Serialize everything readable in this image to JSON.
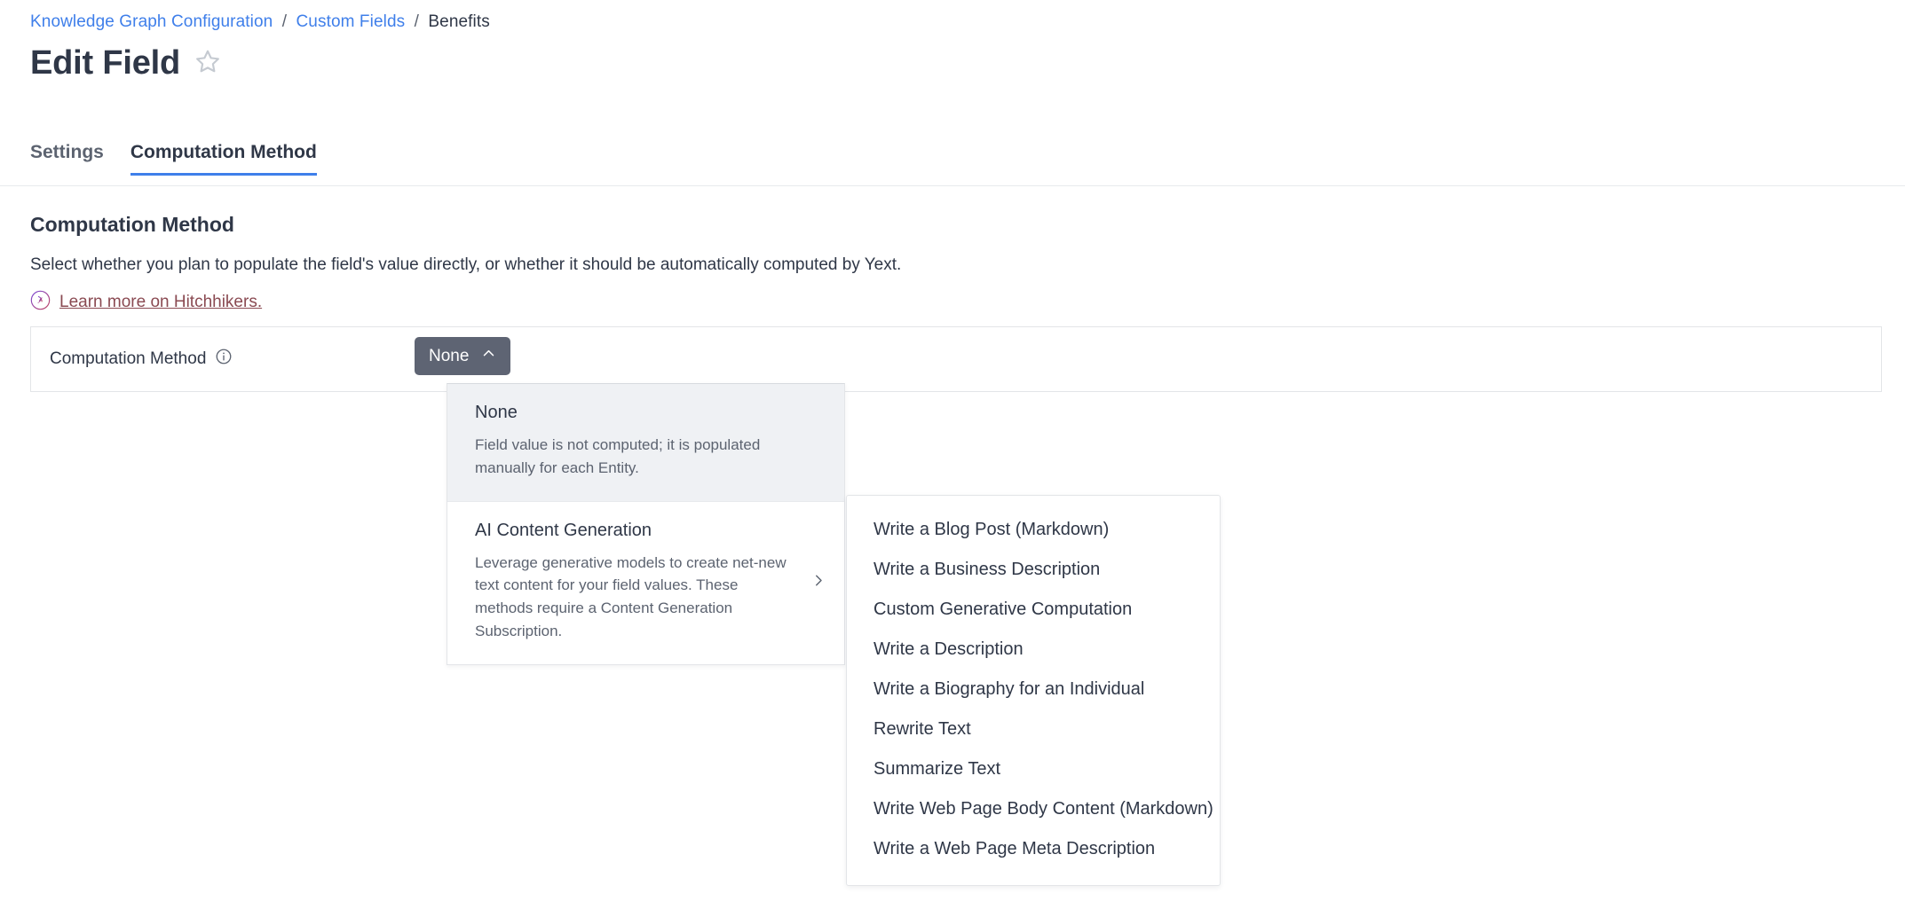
{
  "breadcrumb": {
    "items": [
      {
        "label": "Knowledge Graph Configuration",
        "link": true
      },
      {
        "label": "Custom Fields",
        "link": true
      },
      {
        "label": "Benefits",
        "link": false
      }
    ],
    "separator": "/"
  },
  "header": {
    "title": "Edit Field",
    "favorite_icon": "star-outline-icon"
  },
  "tabs": [
    {
      "label": "Settings",
      "active": false
    },
    {
      "label": "Computation Method",
      "active": true
    }
  ],
  "section": {
    "title": "Computation Method",
    "description": "Select whether you plan to populate the field's value directly, or whether it should be automatically computed by Yext.",
    "learn_more_link": "Learn more on Hitchhikers.",
    "learn_more_icon": "hitchhikers-logo-icon"
  },
  "field_row": {
    "label": "Computation Method",
    "info_icon": "info-circle-icon",
    "dropdown_value": "None",
    "dropdown_chevron": "chevron-up-icon",
    "dropdown_open": true
  },
  "menu": {
    "options": [
      {
        "title": "None",
        "description": "Field value is not computed; it is populated manually for each Entity.",
        "selected": true,
        "has_submenu": false
      },
      {
        "title": "AI Content Generation",
        "description": "Leverage generative models to create net-new text content for your field values. These methods require a Content Generation Subscription.",
        "selected": false,
        "has_submenu": true,
        "submenu_icon": "chevron-right-icon"
      }
    ]
  },
  "submenu": {
    "items": [
      {
        "label": "Write a Blog Post (Markdown)"
      },
      {
        "label": "Write a Business Description"
      },
      {
        "label": "Custom Generative Computation"
      },
      {
        "label": "Write a Description"
      },
      {
        "label": "Write a Biography for an Individual"
      },
      {
        "label": "Rewrite Text"
      },
      {
        "label": "Summarize Text"
      },
      {
        "label": "Write Web Page Body Content (Markdown)"
      },
      {
        "label": "Write a Web Page Meta Description"
      }
    ]
  },
  "colors": {
    "link": "#3f7fea",
    "text": "#2f3747",
    "muted": "#5c6370",
    "accent_tab_underline": "#3f7fea",
    "dropdown_button_bg": "#5e6473",
    "selected_option_bg": "#eff1f4",
    "learn_link": "#8a4a52",
    "border": "#e3e5e8"
  }
}
